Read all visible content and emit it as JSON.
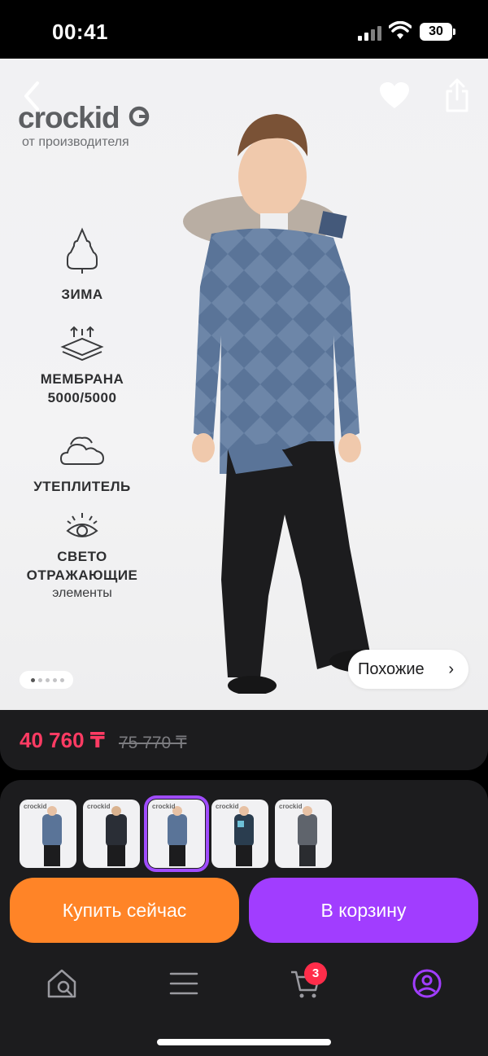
{
  "status": {
    "time": "00:41",
    "battery": "30"
  },
  "brand": {
    "name": "crockid",
    "subtitle": "от производителя"
  },
  "features": [
    {
      "label": "ЗИМА",
      "icon": "snow-tree-icon"
    },
    {
      "label": "МЕМБРАНА 5000/5000",
      "line1": "МЕМБРАНА",
      "line2": "5000/5000",
      "icon": "membrane-icon"
    },
    {
      "label": "УТЕПЛИТЕЛЬ",
      "icon": "insulation-cloud-icon"
    },
    {
      "line1": "СВЕТО",
      "line2": "ОТРАЖАЮЩИЕ",
      "line3": "элементы",
      "icon": "reflective-eye-icon"
    }
  ],
  "gallery": {
    "page": 1,
    "total": 5,
    "similar_label": "Похожие"
  },
  "price": {
    "current": "40 760 ₸",
    "old": "75 770 ₸"
  },
  "variants": {
    "count": 5,
    "selected_index": 2,
    "thumb_logo": "crockid"
  },
  "actions": {
    "buy_now": "Купить сейчас",
    "add_to_cart": "В корзину"
  },
  "tabbar": {
    "cart_badge": "3",
    "active": "profile"
  },
  "colors": {
    "accent_purple": "#a13dff",
    "accent_orange": "#ff8427",
    "price_red": "#ff3b63",
    "badge_red": "#ff2d4a"
  }
}
